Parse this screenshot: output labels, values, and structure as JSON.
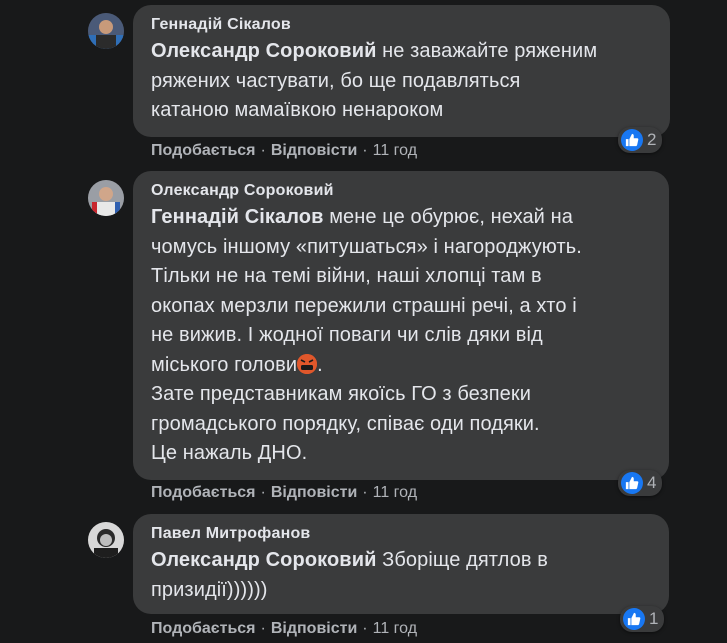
{
  "comments": [
    {
      "author": "Геннадій Сікалов",
      "mention": "Олександр Сороковий",
      "text_lines": [
        " не заважайте ряженим",
        "ряжених частувати, бо ще подавляться",
        "катаною мамаївкою ненароком"
      ],
      "reactions": "2",
      "like_label": "Подобається",
      "reply_label": "Відповісти",
      "time": "11 год"
    },
    {
      "author": "Олександр Сороковий",
      "mention": "Геннадій Сікалов",
      "text_lines": [
        " мене це обурює, нехай на",
        "чомусь іншому «питушаться» і нагороджують.",
        "Тільки не на темі війни, наші хлопці там в",
        "окопах мерзли пережили страшні речі, а хто і",
        "не вижив. І жодної поваги чи слів дяки від",
        "міського голови",
        "Зате представникам якоїсь ГО з безпеки",
        "громадського порядку, співає оди подяки.",
        "Це нажаль ДНО."
      ],
      "line6_suffix": ".",
      "emoji_name": "angry-cursing-emoji",
      "reactions": "4",
      "like_label": "Подобається",
      "reply_label": "Відповісти",
      "time": "11 год"
    },
    {
      "author": "Павел Митрофанов",
      "mention": "Олександр Сороковий",
      "text_lines": [
        " Зборіще дятлов в",
        "призидії))))))"
      ],
      "reactions": "1",
      "like_label": "Подобається",
      "reply_label": "Відповісти",
      "time": "11 год"
    }
  ],
  "separator": "·",
  "colors": {
    "background": "#18191a",
    "bubble": "#3a3b3c",
    "text": "#e4e6eb",
    "secondary": "#b0b3b8",
    "like": "#1877f2"
  }
}
